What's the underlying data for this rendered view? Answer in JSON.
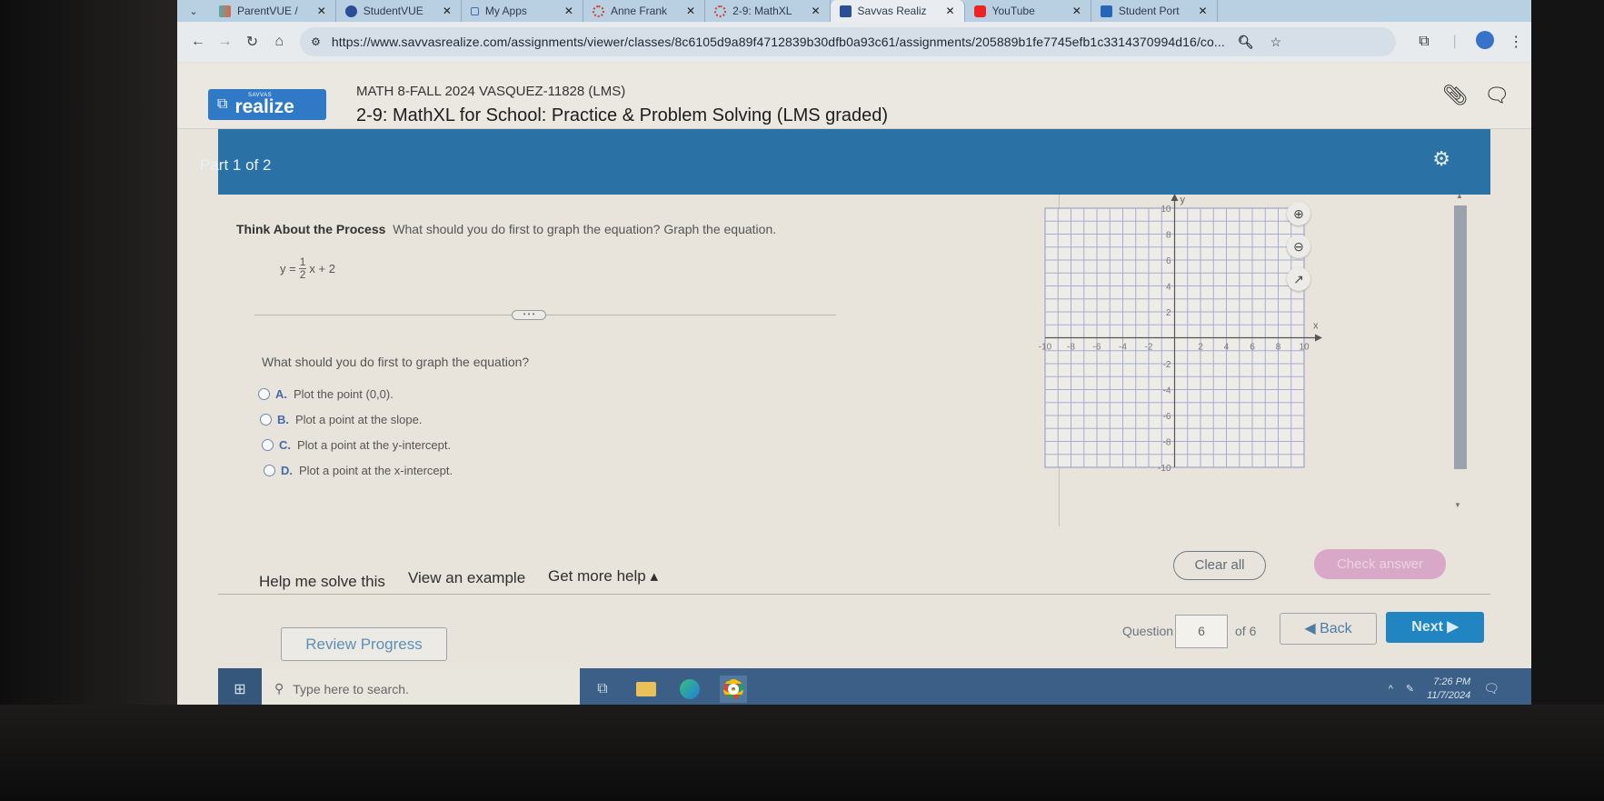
{
  "browser": {
    "tabs": [
      {
        "label": "ParentVUE /",
        "icon": "parentvue-icon",
        "active": false
      },
      {
        "label": "StudentVUE",
        "icon": "studentvue-icon",
        "active": false
      },
      {
        "label": "My Apps",
        "icon": "myapps-icon",
        "active": false
      },
      {
        "label": "Anne Frank",
        "icon": "loading-icon",
        "active": false
      },
      {
        "label": "2-9: MathXL",
        "icon": "loading-icon",
        "active": false
      },
      {
        "label": "Savvas Realiz",
        "icon": "savvas-icon",
        "active": true
      },
      {
        "label": "YouTube",
        "icon": "youtube-icon",
        "active": false
      },
      {
        "label": "Student Port",
        "icon": "student-portal-icon",
        "active": false
      }
    ],
    "url": "https://www.savvasrealize.com/assignments/viewer/classes/8c6105d9a89f4712839b30dfb0a93c61/assignments/205889b1fe7745efb1c3314370994d16/co..."
  },
  "app": {
    "logo_small": "SAVVAS",
    "logo": "realize",
    "course": "MATH 8-FALL 2024 VASQUEZ-11828 (LMS)",
    "assignment_title": "2-9: MathXL for School: Practice & Problem Solving (LMS graded)",
    "brand_color": "#2a72a6"
  },
  "part": {
    "label": "Part 1 of 2"
  },
  "question": {
    "lead_bold": "Think About the Process",
    "prompt": "What should you do first to graph the equation? Graph the equation.",
    "equation": {
      "lhs": "y =",
      "numerator": "1",
      "denominator": "2",
      "rest": "x + 2"
    },
    "sub_question": "What should you do first to graph the equation?",
    "choices": [
      {
        "letter": "A.",
        "text": "Plot the point (0,0)."
      },
      {
        "letter": "B.",
        "text": "Plot a point at the slope."
      },
      {
        "letter": "C.",
        "text": "Plot a point at the y-intercept."
      },
      {
        "letter": "D.",
        "text": "Plot a point at the x-intercept."
      }
    ]
  },
  "graph": {
    "x_label": "x",
    "y_label": "y",
    "x_range": [
      -10,
      10
    ],
    "y_range": [
      -10,
      10
    ],
    "x_ticks": [
      "-10",
      "-8",
      "-6",
      "-4",
      "-2",
      "2",
      "4",
      "6",
      "8",
      "10"
    ],
    "y_ticks": [
      "10",
      "8",
      "6",
      "4",
      "2",
      "-2",
      "-4",
      "-6",
      "-8",
      "-10"
    ],
    "grid_step": 1,
    "tools": [
      "zoom-in",
      "zoom-out",
      "pop-out"
    ]
  },
  "help": {
    "help_me": "Help me solve this",
    "example": "View an example",
    "more_help": "Get more help ▴",
    "clear_all": "Clear all",
    "check_answer": "Check answer"
  },
  "navigation": {
    "review": "Review Progress",
    "question_label": "Question",
    "current": "6",
    "of_total": "of 6",
    "back": "◀ Back",
    "next": "Next ▶"
  },
  "taskbar": {
    "search_placeholder": "Type here to search.",
    "time": "7:26 PM",
    "date": "11/7/2024"
  }
}
